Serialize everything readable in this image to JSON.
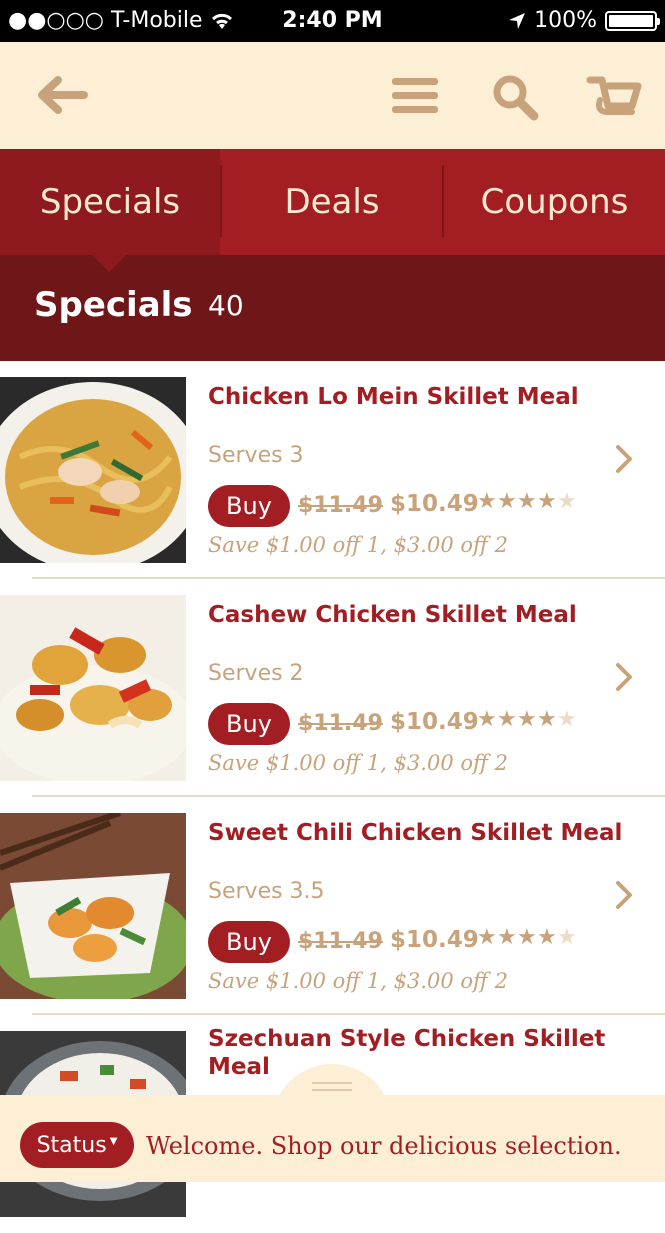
{
  "status_bar": {
    "carrier": "●●○○○ T-Mobile",
    "time": "2:40 PM",
    "battery": "100%"
  },
  "nav": {
    "back": "back-arrow-icon",
    "menu": "menu-icon",
    "search": "search-icon",
    "cart": "cart-icon"
  },
  "tabs": [
    {
      "label": "Specials",
      "active": true
    },
    {
      "label": "Deals",
      "active": false
    },
    {
      "label": "Coupons",
      "active": false
    }
  ],
  "section": {
    "title": "Specials",
    "count": "40"
  },
  "items": [
    {
      "name": "Chicken Lo Mein Skillet Meal",
      "serves": "Serves 3",
      "buy_label": "Buy",
      "old_price": "$11.49",
      "new_price": "$10.49",
      "rating": 4.5,
      "save": "Save $1.00 off 1, $3.00 off 2"
    },
    {
      "name": "Cashew Chicken Skillet Meal",
      "serves": "Serves 2",
      "buy_label": "Buy",
      "old_price": "$11.49",
      "new_price": "$10.49",
      "rating": 4.5,
      "save": "Save $1.00 off 1, $3.00 off 2"
    },
    {
      "name": "Sweet Chili Chicken Skillet Meal",
      "serves": "Serves 3.5",
      "buy_label": "Buy",
      "old_price": "$11.49",
      "new_price": "$10.49",
      "rating": 4.5,
      "save": "Save $1.00 off 1, $3.00 off 2"
    },
    {
      "name": "Szechuan Style Chicken Skillet Meal"
    }
  ],
  "bottom": {
    "status_label": "Status",
    "message": "Welcome. Shop our delicious selection."
  },
  "colors": {
    "brand_red": "#a31e22",
    "dark_red": "#6e1618",
    "tan": "#c8a27a",
    "cream": "#fcefd6"
  }
}
